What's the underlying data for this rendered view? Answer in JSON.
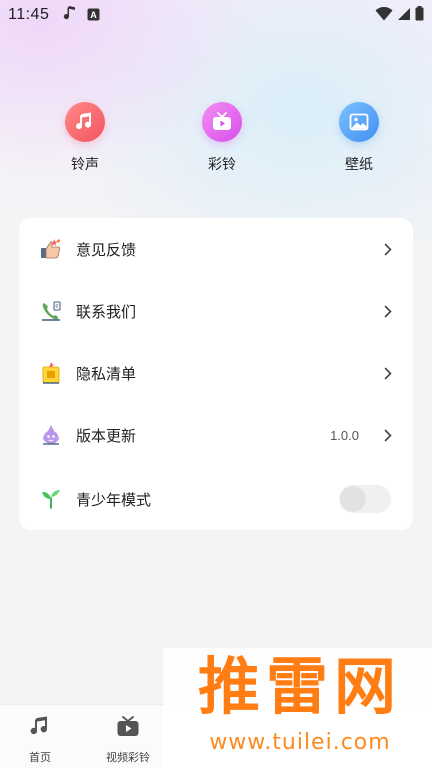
{
  "status_bar": {
    "time": "11:45",
    "left_icons": [
      "music-note-icon",
      "a-badge-icon"
    ],
    "right_icons": [
      "wifi-icon",
      "signal-icon",
      "battery-icon"
    ]
  },
  "quick_actions": [
    {
      "label": "铃声",
      "icon": "music-note-icon",
      "color": "#f25360"
    },
    {
      "label": "彩铃",
      "icon": "tv-play-icon",
      "color": "#d64fe8"
    },
    {
      "label": "壁纸",
      "icon": "image-icon",
      "color": "#3f8ff2"
    }
  ],
  "settings": {
    "items": [
      {
        "label": "意见反馈",
        "icon": "thumbs-up-icon"
      },
      {
        "label": "联系我们",
        "icon": "phone-icon"
      },
      {
        "label": "隐私清单",
        "icon": "privacy-list-icon"
      },
      {
        "label": "版本更新",
        "icon": "update-icon",
        "value": "1.0.0"
      },
      {
        "label": "青少年模式",
        "icon": "sprout-icon",
        "toggle": false
      }
    ]
  },
  "bottom_nav": {
    "items": [
      {
        "label": "首页",
        "icon": "music-note-icon"
      },
      {
        "label": "视频彩铃",
        "icon": "tv-play-icon"
      }
    ]
  },
  "watermark": {
    "title": "推雷网",
    "url": "www.tuilei.com"
  },
  "colors": {
    "accent_red": "#f25360",
    "accent_purple": "#d64fe8",
    "accent_blue": "#3f8ff2",
    "watermark_orange": "#ff7d12"
  }
}
